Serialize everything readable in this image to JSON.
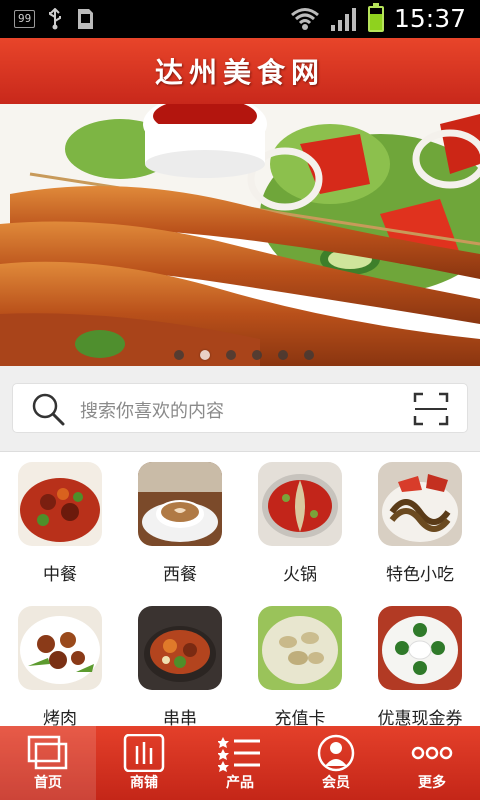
{
  "status_bar": {
    "notification_count": "99",
    "time": "15:37"
  },
  "header": {
    "title": "达州美食网"
  },
  "banner": {
    "slide_count": 6,
    "active_slide": 1
  },
  "search": {
    "placeholder": "搜索你喜欢的内容"
  },
  "categories": [
    {
      "label": "中餐"
    },
    {
      "label": "西餐"
    },
    {
      "label": "火锅"
    },
    {
      "label": "特色小吃"
    },
    {
      "label": "烤肉"
    },
    {
      "label": "串串"
    },
    {
      "label": "充值卡"
    },
    {
      "label": "优惠现金券"
    }
  ],
  "tabbar": {
    "items": [
      {
        "label": "首页",
        "icon": "home-icon",
        "active": true
      },
      {
        "label": "商铺",
        "icon": "shop-icon"
      },
      {
        "label": "产品",
        "icon": "product-list-icon"
      },
      {
        "label": "会员",
        "icon": "member-icon"
      },
      {
        "label": "更多",
        "icon": "more-icon"
      }
    ]
  },
  "colors": {
    "primary": "#d8321f",
    "status_bar": "#000000",
    "battery": "#8fd21e"
  }
}
